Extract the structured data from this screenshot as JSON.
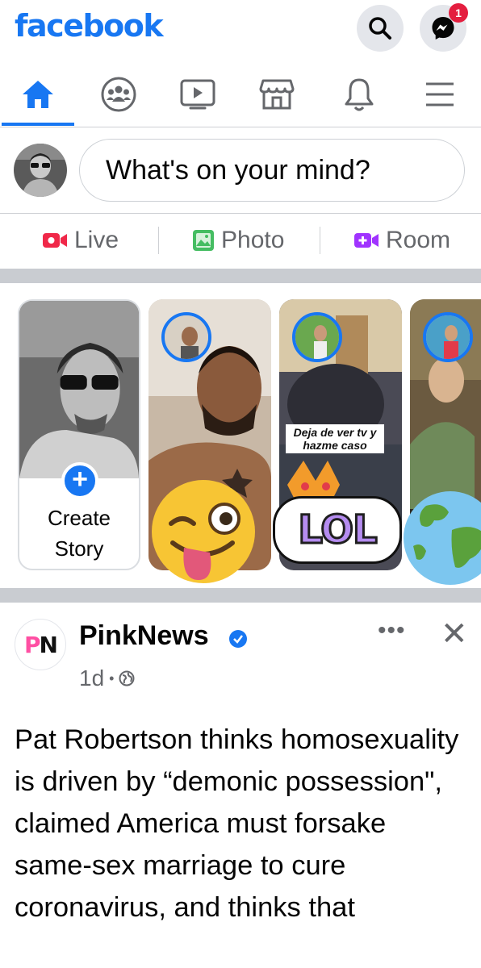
{
  "header": {
    "logo": "facebook",
    "messenger_badge": "1",
    "icons": [
      "search-icon",
      "messenger-icon"
    ]
  },
  "nav": {
    "tabs": [
      {
        "name": "home",
        "icon": "home-icon",
        "active": true
      },
      {
        "name": "groups",
        "icon": "groups-icon"
      },
      {
        "name": "watch",
        "icon": "video-icon"
      },
      {
        "name": "marketplace",
        "icon": "marketplace-icon"
      },
      {
        "name": "notifications",
        "icon": "bell-icon"
      },
      {
        "name": "menu",
        "icon": "menu-icon"
      }
    ]
  },
  "composer": {
    "placeholder": "What's on your mind?"
  },
  "actions": {
    "live": "Live",
    "photo": "Photo",
    "room": "Room"
  },
  "stories": {
    "create_line1": "Create",
    "create_line2": "Story",
    "sticker_caption": "Deja de ver tv y hazme caso",
    "lol": "LOL"
  },
  "post": {
    "page_name": "PinkNews",
    "page_initials": "PN",
    "time": "1d",
    "separator": "•",
    "more": "•••",
    "close": "✕",
    "text": "Pat Robertson thinks homosexuality is driven by “demonic possession\", claimed America must forsake same-sex marriage to cure coronavirus, and thinks that"
  },
  "colors": {
    "brand": "#1877f2",
    "badge": "#e41e3f",
    "live": "#f02849",
    "photo": "#45bd62",
    "room": "#a033ff"
  }
}
